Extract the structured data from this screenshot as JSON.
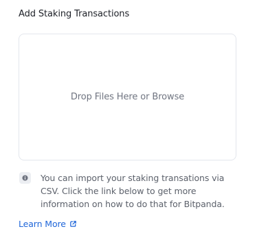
{
  "section": {
    "title": "Add Staking Transactions"
  },
  "dropzone": {
    "label": "Drop Files Here or Browse"
  },
  "info": {
    "icon": "info-icon",
    "text": "You can import your staking transations via CSV. Click the link below to get more information on how to do that for Bitpanda."
  },
  "link": {
    "label": "Learn More",
    "icon": "external-link-icon",
    "color": "#1f66d9"
  }
}
